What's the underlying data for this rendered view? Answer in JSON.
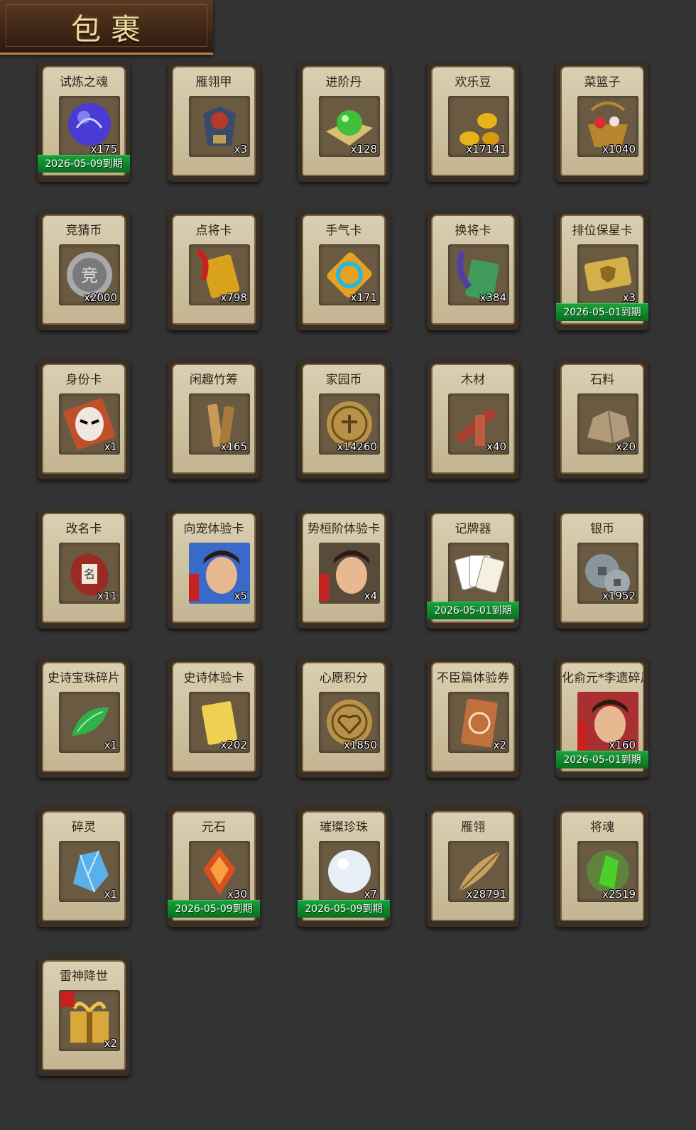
{
  "header": {
    "title": "包裹"
  },
  "items": [
    {
      "name": "试炼之魂",
      "count": "x175",
      "expiry": "2026-05-09到期",
      "icon": "dragon-orb-icon",
      "color": "#4a3bd6"
    },
    {
      "name": "雁翎甲",
      "count": "x3",
      "expiry": "",
      "icon": "armor-icon",
      "color": "#b83a2a"
    },
    {
      "name": "进阶丹",
      "count": "x128",
      "expiry": "",
      "icon": "green-pill-icon",
      "color": "#3fbf3a"
    },
    {
      "name": "欢乐豆",
      "count": "x17141",
      "expiry": "",
      "icon": "gold-beans-icon",
      "color": "#e8b21a"
    },
    {
      "name": "菜篮子",
      "count": "x1040",
      "expiry": "",
      "icon": "basket-icon",
      "color": "#b8862e"
    },
    {
      "name": "竞猜币",
      "count": "x2000",
      "expiry": "",
      "icon": "silver-coin-icon",
      "color": "#a9a9a9"
    },
    {
      "name": "点将卡",
      "count": "x798",
      "expiry": "",
      "icon": "general-card-icon",
      "color": "#d9a21e"
    },
    {
      "name": "手气卡",
      "count": "x171",
      "expiry": "",
      "icon": "luck-card-icon",
      "color": "#2ab8d8"
    },
    {
      "name": "换将卡",
      "count": "x384",
      "expiry": "",
      "icon": "swap-card-icon",
      "color": "#3f9c5a"
    },
    {
      "name": "排位保星卡",
      "count": "x3",
      "expiry": "2026-05-01到期",
      "icon": "star-shield-card-icon",
      "color": "#d4b04a"
    },
    {
      "name": "身份卡",
      "count": "x1",
      "expiry": "",
      "icon": "opera-mask-card-icon",
      "color": "#c0502a"
    },
    {
      "name": "闲趣竹筹",
      "count": "x165",
      "expiry": "",
      "icon": "bamboo-token-icon",
      "color": "#c79a55"
    },
    {
      "name": "家园币",
      "count": "x14260",
      "expiry": "",
      "icon": "home-coin-icon",
      "color": "#b89248"
    },
    {
      "name": "木材",
      "count": "x40",
      "expiry": "",
      "icon": "wood-icon",
      "color": "#a8402e"
    },
    {
      "name": "石料",
      "count": "x20",
      "expiry": "",
      "icon": "stone-icon",
      "color": "#b09a7a"
    },
    {
      "name": "改名卡",
      "count": "x11",
      "expiry": "",
      "icon": "rename-card-icon",
      "color": "#9a2a24"
    },
    {
      "name": "向宠体验卡",
      "count": "x5",
      "expiry": "",
      "icon": "hero-portrait-icon",
      "color": "#3a6ac8"
    },
    {
      "name": "势桓阶体验卡",
      "count": "x4",
      "expiry": "",
      "icon": "hero-portrait-icon",
      "color": "#5a4a3a"
    },
    {
      "name": "记牌器",
      "count": "",
      "expiry": "2026-05-01到期",
      "icon": "playing-cards-icon",
      "color": "#eeeeee"
    },
    {
      "name": "银币",
      "count": "x1952",
      "expiry": "",
      "icon": "silver-coins-icon",
      "color": "#8a949c"
    },
    {
      "name": "史诗宝珠碎片",
      "count": "x1",
      "expiry": "",
      "icon": "jade-shard-icon",
      "color": "#2fb04a"
    },
    {
      "name": "史诗体验卡",
      "count": "x202",
      "expiry": "",
      "icon": "gold-card-icon",
      "color": "#f0d050"
    },
    {
      "name": "心愿积分",
      "count": "x1850",
      "expiry": "",
      "icon": "heart-coin-icon",
      "color": "#b89248"
    },
    {
      "name": "不臣篇体验券",
      "count": "x2",
      "expiry": "",
      "icon": "ticket-icon",
      "color": "#c0703a"
    },
    {
      "name": "化俞元*李遗碎片",
      "count": "x160",
      "expiry": "2026-05-01到期",
      "icon": "hero-portrait-icon",
      "color": "#a83030"
    },
    {
      "name": "碎灵",
      "count": "x1",
      "expiry": "",
      "icon": "crystal-icon",
      "color": "#5ab0e8"
    },
    {
      "name": "元石",
      "count": "x30",
      "expiry": "2026-05-09到期",
      "icon": "fire-stone-icon",
      "color": "#d8501e"
    },
    {
      "name": "璀璨珍珠",
      "count": "x7",
      "expiry": "2026-05-09到期",
      "icon": "pearl-icon",
      "color": "#e8eef5"
    },
    {
      "name": "雁翎",
      "count": "x28791",
      "expiry": "",
      "icon": "feather-icon",
      "color": "#c8a060"
    },
    {
      "name": "将魂",
      "count": "x2519",
      "expiry": "",
      "icon": "green-soul-icon",
      "color": "#4ad02a"
    },
    {
      "name": "雷神降世",
      "count": "x2",
      "expiry": "",
      "icon": "gift-box-icon",
      "color": "#d8a83a"
    }
  ]
}
